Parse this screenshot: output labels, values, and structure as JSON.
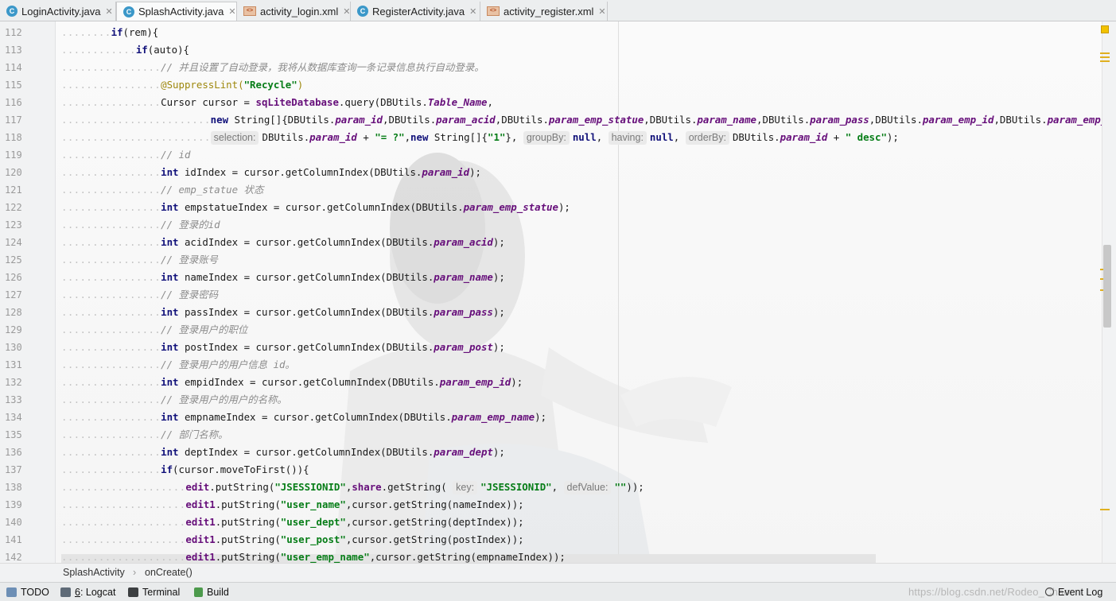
{
  "tabs": [
    {
      "label": "LoginActivity.java",
      "kind": "java",
      "active": false
    },
    {
      "label": "SplashActivity.java",
      "kind": "java",
      "active": true
    },
    {
      "label": "activity_login.xml",
      "kind": "xml",
      "active": false
    },
    {
      "label": "RegisterActivity.java",
      "kind": "java",
      "active": false
    },
    {
      "label": "activity_register.xml",
      "kind": "xml",
      "active": false
    }
  ],
  "editor": {
    "lines": [
      {
        "no": "112",
        "indent": 2,
        "parts": [
          [
            "kw",
            "if"
          ],
          [
            "",
            "(rem){"
          ]
        ]
      },
      {
        "no": "113",
        "indent": 3,
        "parts": [
          [
            "kw",
            "if"
          ],
          [
            "",
            "(auto){"
          ]
        ]
      },
      {
        "no": "114",
        "indent": 4,
        "parts": [
          [
            "cmt",
            "// 并且设置了自动登录，我将从数据库查询一条记录信息执行自动登录。"
          ]
        ]
      },
      {
        "no": "115",
        "indent": 4,
        "parts": [
          [
            "ann",
            "@SuppressLint("
          ],
          [
            "str",
            "\"Recycle\""
          ],
          [
            "ann",
            ")"
          ]
        ]
      },
      {
        "no": "116",
        "indent": 4,
        "parts": [
          [
            "",
            "Cursor cursor = "
          ],
          [
            "bfld",
            "sqLiteDatabase"
          ],
          [
            "",
            ".query(DBUtils."
          ],
          [
            "fld",
            "Table_Name"
          ],
          [
            "",
            ","
          ]
        ]
      },
      {
        "no": "117",
        "indent": 6,
        "parts": [
          [
            "kw",
            "new"
          ],
          [
            "",
            " String[]{DBUtils."
          ],
          [
            "fld",
            "param_id"
          ],
          [
            "",
            ",DBUtils."
          ],
          [
            "fld",
            "param_acid"
          ],
          [
            "",
            ",DBUtils."
          ],
          [
            "fld",
            "param_emp_statue"
          ],
          [
            "",
            ",DBUtils."
          ],
          [
            "fld",
            "param_name"
          ],
          [
            "",
            ",DBUtils."
          ],
          [
            "fld",
            "param_pass"
          ],
          [
            "",
            ",DBUtils."
          ],
          [
            "fld",
            "param_emp_id"
          ],
          [
            "",
            ",DBUtils."
          ],
          [
            "fld",
            "param_emp_na"
          ]
        ]
      },
      {
        "no": "118",
        "indent": 6,
        "parts": [
          [
            "hint",
            "selection:"
          ],
          [
            "",
            "DBUtils."
          ],
          [
            "fld",
            "param_id"
          ],
          [
            "",
            " + "
          ],
          [
            "str",
            "\"= ?\""
          ],
          [
            "",
            ","
          ],
          [
            "kw",
            "new"
          ],
          [
            "",
            " String[]{"
          ],
          [
            "str",
            "\"1\""
          ],
          [
            "",
            "}, "
          ],
          [
            "hint",
            "groupBy:"
          ],
          [
            "kw",
            "null"
          ],
          [
            "",
            ", "
          ],
          [
            "hint",
            "having:"
          ],
          [
            "kw",
            "null"
          ],
          [
            "",
            ", "
          ],
          [
            "hint",
            "orderBy:"
          ],
          [
            "",
            "DBUtils."
          ],
          [
            "fld",
            "param_id"
          ],
          [
            "",
            " + "
          ],
          [
            "str",
            "\" desc\""
          ],
          [
            "",
            ");"
          ]
        ]
      },
      {
        "no": "119",
        "indent": 4,
        "parts": [
          [
            "cmt",
            "// id"
          ]
        ]
      },
      {
        "no": "120",
        "indent": 4,
        "parts": [
          [
            "kw",
            "int"
          ],
          [
            "",
            " idIndex = cursor.getColumnIndex(DBUtils."
          ],
          [
            "fld",
            "param_id"
          ],
          [
            "",
            ");"
          ]
        ]
      },
      {
        "no": "121",
        "indent": 4,
        "parts": [
          [
            "cmt",
            "// emp_statue 状态"
          ]
        ]
      },
      {
        "no": "122",
        "indent": 4,
        "parts": [
          [
            "kw",
            "int"
          ],
          [
            "",
            " empstatueIndex = cursor.getColumnIndex(DBUtils."
          ],
          [
            "fld",
            "param_emp_statue"
          ],
          [
            "",
            ");"
          ]
        ]
      },
      {
        "no": "123",
        "indent": 4,
        "parts": [
          [
            "cmt",
            "// 登录的id"
          ]
        ]
      },
      {
        "no": "124",
        "indent": 4,
        "parts": [
          [
            "kw",
            "int"
          ],
          [
            "",
            " acidIndex = cursor.getColumnIndex(DBUtils."
          ],
          [
            "fld",
            "param_acid"
          ],
          [
            "",
            ");"
          ]
        ]
      },
      {
        "no": "125",
        "indent": 4,
        "parts": [
          [
            "cmt",
            "// 登录账号"
          ]
        ]
      },
      {
        "no": "126",
        "indent": 4,
        "parts": [
          [
            "kw",
            "int"
          ],
          [
            "",
            " nameIndex = cursor.getColumnIndex(DBUtils."
          ],
          [
            "fld",
            "param_name"
          ],
          [
            "",
            ");"
          ]
        ]
      },
      {
        "no": "127",
        "indent": 4,
        "parts": [
          [
            "cmt",
            "// 登录密码"
          ]
        ]
      },
      {
        "no": "128",
        "indent": 4,
        "parts": [
          [
            "kw",
            "int"
          ],
          [
            "",
            " passIndex = cursor.getColumnIndex(DBUtils."
          ],
          [
            "fld",
            "param_pass"
          ],
          [
            "",
            ");"
          ]
        ]
      },
      {
        "no": "129",
        "indent": 4,
        "parts": [
          [
            "cmt",
            "// 登录用户的职位"
          ]
        ]
      },
      {
        "no": "130",
        "indent": 4,
        "parts": [
          [
            "kw",
            "int"
          ],
          [
            "",
            " postIndex = cursor.getColumnIndex(DBUtils."
          ],
          [
            "fld",
            "param_post"
          ],
          [
            "",
            ");"
          ]
        ]
      },
      {
        "no": "131",
        "indent": 4,
        "parts": [
          [
            "cmt",
            "// 登录用户的用户信息 id。"
          ]
        ]
      },
      {
        "no": "132",
        "indent": 4,
        "parts": [
          [
            "kw",
            "int"
          ],
          [
            "",
            " empidIndex = cursor.getColumnIndex(DBUtils."
          ],
          [
            "fld",
            "param_emp_id"
          ],
          [
            "",
            ");"
          ]
        ]
      },
      {
        "no": "133",
        "indent": 4,
        "parts": [
          [
            "cmt",
            "// 登录用户的用户的名称。"
          ]
        ]
      },
      {
        "no": "134",
        "indent": 4,
        "parts": [
          [
            "kw",
            "int"
          ],
          [
            "",
            " empnameIndex = cursor.getColumnIndex(DBUtils."
          ],
          [
            "fld",
            "param_emp_name"
          ],
          [
            "",
            ");"
          ]
        ]
      },
      {
        "no": "135",
        "indent": 4,
        "parts": [
          [
            "cmt",
            "// 部门名称。"
          ]
        ]
      },
      {
        "no": "136",
        "indent": 4,
        "parts": [
          [
            "kw",
            "int"
          ],
          [
            "",
            " deptIndex = cursor.getColumnIndex(DBUtils."
          ],
          [
            "fld",
            "param_dept"
          ],
          [
            "",
            ");"
          ]
        ]
      },
      {
        "no": "137",
        "indent": 4,
        "parts": [
          [
            "kw",
            "if"
          ],
          [
            "",
            "(cursor.moveToFirst()){"
          ]
        ]
      },
      {
        "no": "138",
        "indent": 5,
        "parts": [
          [
            "bfld",
            "edit"
          ],
          [
            "",
            ".putString("
          ],
          [
            "str",
            "\"JSESSIONID\""
          ],
          [
            "",
            ","
          ],
          [
            "bfld",
            "share"
          ],
          [
            "",
            ".getString( "
          ],
          [
            "hint",
            "key:"
          ],
          [
            "str",
            "\"JSESSIONID\""
          ],
          [
            "",
            ", "
          ],
          [
            "hint",
            "defValue:"
          ],
          [
            "str",
            "\"\""
          ],
          [
            "",
            "));"
          ]
        ]
      },
      {
        "no": "139",
        "indent": 5,
        "parts": [
          [
            "bfld",
            "edit1"
          ],
          [
            "",
            ".putString("
          ],
          [
            "str",
            "\"user_name\""
          ],
          [
            "",
            ",cursor.getString(nameIndex));"
          ]
        ]
      },
      {
        "no": "140",
        "indent": 5,
        "parts": [
          [
            "bfld",
            "edit1"
          ],
          [
            "",
            ".putString("
          ],
          [
            "str",
            "\"user_dept\""
          ],
          [
            "",
            ",cursor.getString(deptIndex));"
          ]
        ]
      },
      {
        "no": "141",
        "indent": 5,
        "parts": [
          [
            "bfld",
            "edit1"
          ],
          [
            "",
            ".putString("
          ],
          [
            "str",
            "\"user_post\""
          ],
          [
            "",
            ",cursor.getString(postIndex));"
          ]
        ]
      },
      {
        "no": "142",
        "indent": 5,
        "parts": [
          [
            "bfld",
            "edit1"
          ],
          [
            "",
            ".putString("
          ],
          [
            "str",
            "\"user_emp_name\""
          ],
          [
            "",
            ",cursor.getString(empnameIndex));"
          ]
        ]
      }
    ]
  },
  "breadcrumb": {
    "file": "SplashActivity",
    "method": "onCreate()"
  },
  "toolbar": {
    "todo": "TODO",
    "logcat_num": "6",
    "logcat": ": Logcat",
    "terminal": "Terminal",
    "build": "Build",
    "event_log": "Event Log",
    "watermark": "https://blog.csdn.net/Rodeo_Chao"
  },
  "colors": {
    "keyword": "#11117a",
    "field": "#660e7a",
    "string": "#067d17",
    "comment": "#8c8c8c",
    "annotation": "#9e880d"
  }
}
